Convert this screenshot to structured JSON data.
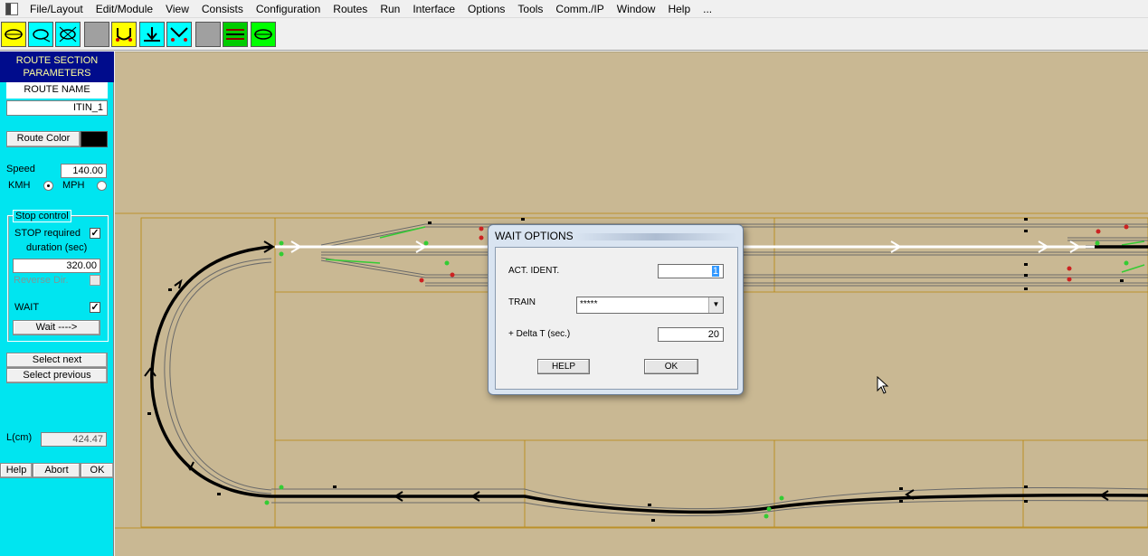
{
  "menu": [
    "File/Layout",
    "Edit/Module",
    "View",
    "Consists",
    "Configuration",
    "Routes",
    "Run",
    "Interface",
    "Options",
    "Tools",
    "Comm./IP",
    "Window",
    "Help",
    "..."
  ],
  "toolbar": {
    "buttons": [
      {
        "name": "route-loop-icon",
        "color": "#ffff00"
      },
      {
        "name": "route-loop-alt-icon",
        "color": "#00ffff"
      },
      {
        "name": "route-cross-icon",
        "color": "#00ffff"
      },
      {
        "name": "blank-icon",
        "color": "#a0a0a0"
      },
      {
        "name": "u-turn-icon",
        "color": "#ffff00"
      },
      {
        "name": "down-arrow-icon",
        "color": "#00ffff"
      },
      {
        "name": "split-icon",
        "color": "#00ffff"
      },
      {
        "name": "blank-icon",
        "color": "#a0a0a0"
      },
      {
        "name": "lines-icon",
        "color": "#00cc00"
      },
      {
        "name": "oval-icon",
        "color": "#00ff00"
      }
    ]
  },
  "left_panel": {
    "header": "ROUTE SECTION PARAMETERS",
    "route_name_label": "ROUTE NAME",
    "route_name_value": "ITIN_1",
    "route_color_label": "Route Color",
    "route_color": "#000000",
    "speed_label": "Speed",
    "speed_value": "140.00",
    "kmh_label": "KMH",
    "mph_label": "MPH",
    "speed_unit_selected": "KMH",
    "stop_control_label": "Stop control",
    "stop_required_label": "STOP required",
    "stop_required_checked": true,
    "duration_label": "duration (sec)",
    "duration_value": "320.00",
    "reverse_dir_label": "Reverse Dir.",
    "reverse_dir_checked": false,
    "wait_label": "WAIT",
    "wait_checked": true,
    "wait_button": "Wait ---->",
    "select_next": "Select next",
    "select_previous": "Select previous",
    "length_label": "L(cm)",
    "length_value": "424.47",
    "help": "Help",
    "abort": "Abort",
    "ok": "OK"
  },
  "dialog": {
    "title": "WAIT OPTIONS",
    "act_ident_label": "ACT. IDENT.",
    "act_ident_value": "1",
    "train_label": "TRAIN",
    "train_value": "*****",
    "delta_label": "+ Delta T (sec.)",
    "delta_value": "20",
    "help_button": "HELP",
    "ok_button": "OK"
  },
  "colors": {
    "canvas_bg": "#c9b893",
    "panel_bg": "#00e5f0",
    "header_bg": "#000c8c",
    "route": "#000000",
    "track": "#808080",
    "signal_green": "#33cc33",
    "signal_red": "#cc2222"
  }
}
